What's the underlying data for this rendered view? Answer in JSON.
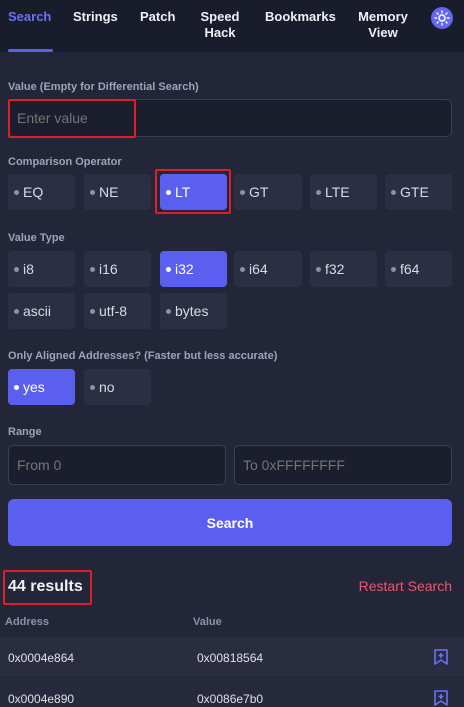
{
  "tabs": [
    {
      "label": "Search",
      "active": true
    },
    {
      "label": "Strings"
    },
    {
      "label": "Patch"
    },
    {
      "label": "Speed\nHack"
    },
    {
      "label": "Bookmarks"
    },
    {
      "label": "Memory\nView"
    }
  ],
  "theme_icon": "sun-icon",
  "value_section": {
    "label": "Value (Empty for Differential Search)",
    "placeholder": "Enter value"
  },
  "comparison": {
    "label": "Comparison Operator",
    "options": [
      "EQ",
      "NE",
      "LT",
      "GT",
      "LTE",
      "GTE"
    ],
    "selected": "LT"
  },
  "value_type": {
    "label": "Value Type",
    "options": [
      "i8",
      "i16",
      "i32",
      "i64",
      "f32",
      "f64",
      "ascii",
      "utf-8",
      "bytes"
    ],
    "selected": "i32"
  },
  "aligned": {
    "label": "Only Aligned Addresses? (Faster but less accurate)",
    "options": [
      "yes",
      "no"
    ],
    "selected": "yes"
  },
  "range": {
    "label": "Range",
    "from_placeholder": "From 0",
    "to_placeholder": "To 0xFFFFFFFF"
  },
  "search_button": "Search",
  "results": {
    "count_label": "44 results",
    "restart_label": "Restart Search",
    "columns": [
      "Address",
      "Value"
    ],
    "rows": [
      {
        "address": "0x0004e864",
        "value": "0x00818564"
      },
      {
        "address": "0x0004e890",
        "value": "0x0086e7b0"
      }
    ]
  },
  "colors": {
    "accent": "#5b5ff0",
    "highlight_box": "#e11d26",
    "restart": "#f2556b"
  }
}
